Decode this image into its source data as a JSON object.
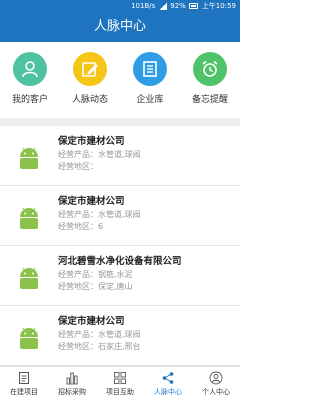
{
  "status": {
    "text": "101B/s",
    "battery": "92%",
    "time": "上午10:59"
  },
  "header": {
    "title": "人脉中心"
  },
  "shortcuts": [
    {
      "label": "我的客户",
      "color": "#4fc3a1",
      "icon": "customer-icon"
    },
    {
      "label": "人脉动态",
      "color": "#f5c518",
      "icon": "edit-icon"
    },
    {
      "label": "企业库",
      "color": "#2f9de4",
      "icon": "document-icon"
    },
    {
      "label": "备忘提醒",
      "color": "#4fc36a",
      "icon": "alarm-clock-icon"
    }
  ],
  "list": {
    "product_prefix": "经营产品：",
    "area_prefix": "经营地区：",
    "items": [
      {
        "name": "保定市建材公司",
        "product": "水管道,球阀",
        "area": ""
      },
      {
        "name": "保定市建材公司",
        "product": "水管道,球阀",
        "area": "6"
      },
      {
        "name": "河北碧雪水净化设备有限公司",
        "product": "钢筋,水泥",
        "area": "保定,唐山"
      },
      {
        "name": "保定市建材公司",
        "product": "水管道,球阀",
        "area": "石家庄,邢台"
      }
    ]
  },
  "tabbar": {
    "active_color": "#1f74bf",
    "tabs": [
      {
        "label": "在建项目",
        "icon": "document-icon"
      },
      {
        "label": "招标采购",
        "icon": "bar-chart-icon"
      },
      {
        "label": "项目互助",
        "icon": "grid-icon"
      },
      {
        "label": "人脉中心",
        "icon": "share-icon"
      },
      {
        "label": "个人中心",
        "icon": "user-icon"
      }
    ]
  }
}
